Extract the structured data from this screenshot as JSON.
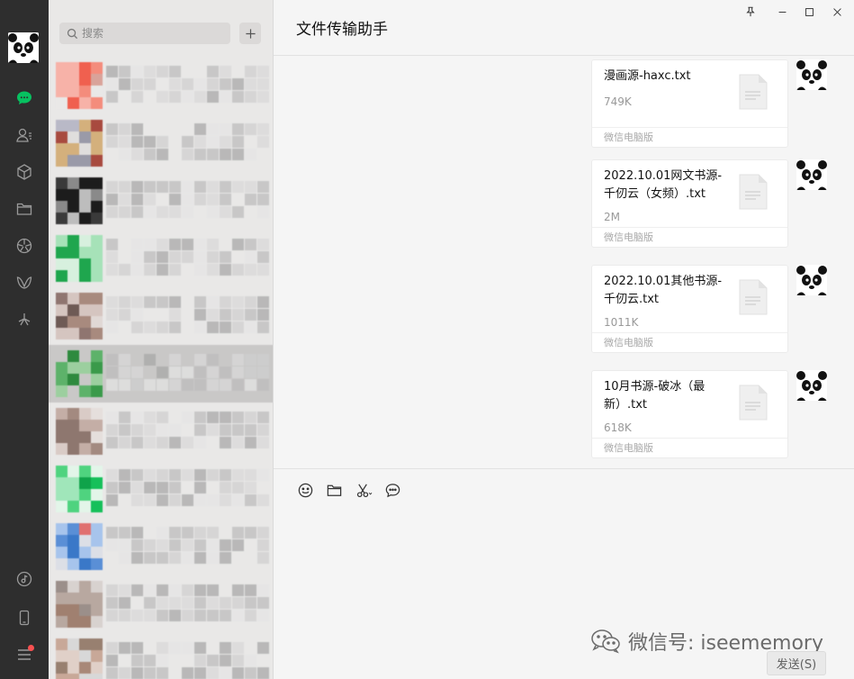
{
  "app": {
    "chat_title": "文件传输助手",
    "colors": {
      "nav_bg": "#2e2e2e",
      "active_green": "#07c160",
      "list_bg": "#e9e8e7",
      "chat_bg": "#f5f5f5",
      "notify_red": "#fa5151"
    }
  },
  "navbar": {
    "items": [
      {
        "icon": "chat-icon",
        "active": true
      },
      {
        "icon": "contacts-icon"
      },
      {
        "icon": "favorites-cube-icon"
      },
      {
        "icon": "folder-icon"
      },
      {
        "icon": "moments-icon"
      },
      {
        "icon": "channels-icon"
      },
      {
        "icon": "miniprogram-icon"
      }
    ],
    "bottom_items": [
      {
        "icon": "music-icon"
      },
      {
        "icon": "phone-icon"
      },
      {
        "icon": "menu-icon",
        "badge": true
      }
    ]
  },
  "search": {
    "placeholder": "搜索"
  },
  "chat_list": {
    "note": "contact names and avatars are pixelated/obscured",
    "selected_index": 5
  },
  "messages": [
    {
      "file_name": "漫画源-haxc.txt",
      "size": "749K",
      "source": "微信电脑版"
    },
    {
      "file_name": "2022.10.01网文书源-千仞云（女频）.txt",
      "size": "2M",
      "source": "微信电脑版"
    },
    {
      "file_name": "2022.10.01其他书源-千仞云.txt",
      "size": "1011K",
      "source": "微信电脑版"
    },
    {
      "file_name": "10月书源-破冰（最新）.txt",
      "size": "618K",
      "source": "微信电脑版"
    }
  ],
  "toolbar": {
    "icons": [
      "emoji-icon",
      "folder-icon",
      "screenshot-scissors-icon",
      "chat-history-icon"
    ]
  },
  "watermark": {
    "text": "微信号: iseememory"
  },
  "send_button": {
    "label": "发送(S)"
  }
}
